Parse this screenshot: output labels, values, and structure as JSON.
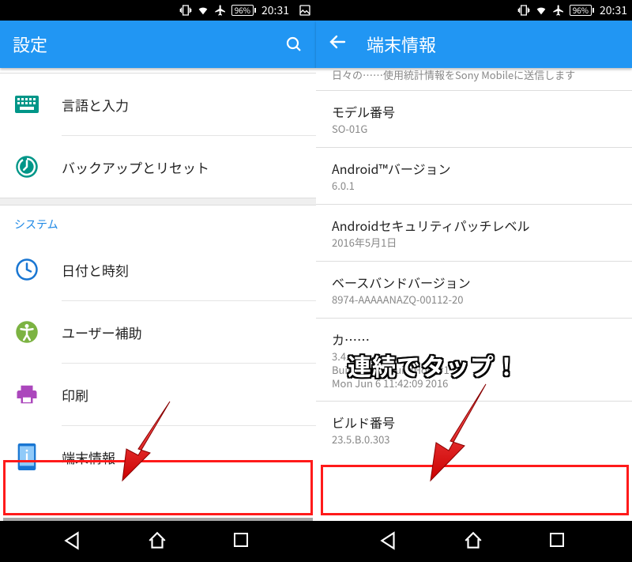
{
  "statusbar": {
    "battery": "96%",
    "time": "20:31"
  },
  "left": {
    "title": "設定",
    "items": {
      "lang": "言語と入力",
      "backup": "バックアップとリセット",
      "section": "システム",
      "datetime": "日付と時刻",
      "accessibility": "ユーザー補助",
      "print": "印刷",
      "about": "端末情報"
    }
  },
  "right": {
    "title": "端末情報",
    "partial": "日々の……使用統計情報をSony Mobileに送信します",
    "model_t": "モデル番号",
    "model_v": "SO-01G",
    "android_t": "Android™バージョン",
    "android_v": "6.0.1",
    "patch_t": "Androidセキュリティパッチレベル",
    "patch_v": "2016年5月1日",
    "baseband_t": "ベースバンドバージョン",
    "baseband_v": "8974-AAAAANAZQ-00112-20",
    "kernel_t": "カ……",
    "kernel_v1": "3.4.……",
    "kernel_v2": "BuildUser@BuildHost #1",
    "kernel_v3": "Mon Jun 6 11:42:09 2016",
    "build_t": "ビルド番号",
    "build_v": "23.5.B.0.303"
  },
  "overlay": "連続でタップ！"
}
